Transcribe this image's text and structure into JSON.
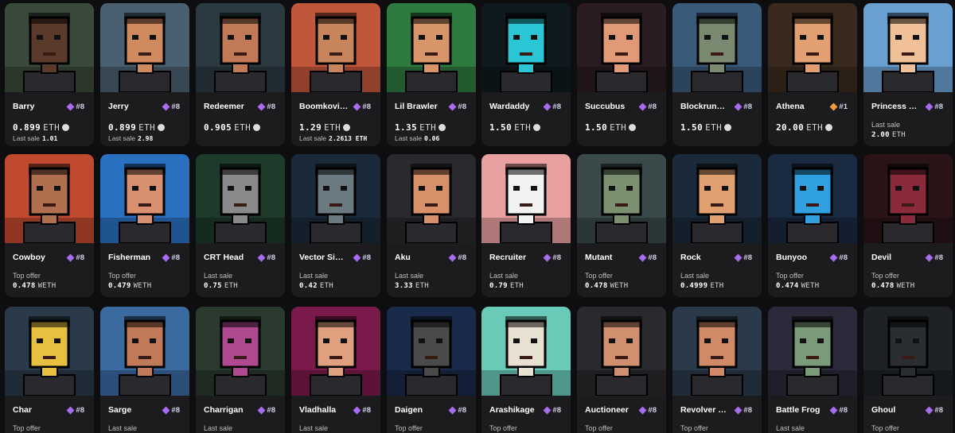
{
  "colors": {
    "background": "#0e0e10",
    "card": "#1c1c1f",
    "rank_gem": "#a86cf0",
    "rank_gem_top": "#f29b38"
  },
  "rows": [
    [
      {
        "name": "Barry",
        "rank": "#8",
        "price": "0.899",
        "currency": "ETH",
        "icon": "offer-icon",
        "sub_label": "Last sale",
        "sub_value": "1.01",
        "bg": "#3a4a3a",
        "skin": "#5a3a2a"
      },
      {
        "name": "Jerry",
        "rank": "#8",
        "price": "0.899",
        "currency": "ETH",
        "icon": "offer-icon",
        "sub_label": "Last sale",
        "sub_value": "2.98",
        "bg": "#4a6070",
        "skin": "#d08a60"
      },
      {
        "name": "Redeemer",
        "rank": "#8",
        "price": "0.905",
        "currency": "ETH",
        "icon": "eth-icon",
        "bg": "#2a3a40",
        "skin": "#c07a58"
      },
      {
        "name": "Boomkovi…",
        "rank": "#8",
        "price": "1.29",
        "currency": "ETH",
        "icon": "eth-icon",
        "sub_label": "Last sale",
        "sub_value": "2.2613 ETH",
        "bg": "#c0563a",
        "skin": "#c8845c"
      },
      {
        "name": "Lil Brawler",
        "rank": "#8",
        "price": "1.35",
        "currency": "ETH",
        "icon": "offer-icon",
        "sub_label": "Last sale",
        "sub_value": "0.06",
        "bg": "#2e7a40",
        "skin": "#d8956a"
      },
      {
        "name": "Wardaddy",
        "rank": "#8",
        "price": "1.50",
        "currency": "ETH",
        "icon": "eth-icon",
        "bg": "#0e1a1e",
        "skin": "#2ac6d6"
      },
      {
        "name": "Succubus",
        "rank": "#8",
        "price": "1.50",
        "currency": "ETH",
        "icon": "eth-icon",
        "bg": "#2a1c22",
        "skin": "#e09a78"
      },
      {
        "name": "Blockrun…",
        "rank": "#8",
        "price": "1.50",
        "currency": "ETH",
        "icon": "eth-icon",
        "bg": "#3a5a7a",
        "skin": "#7a8a70"
      },
      {
        "name": "Athena",
        "rank": "#1",
        "gold": true,
        "price": "20.00",
        "currency": "ETH",
        "icon": "eth-icon",
        "bg": "#3a2a1e",
        "skin": "#e2a072"
      },
      {
        "name": "Princess …",
        "rank": "#8",
        "label2": "Last sale",
        "price2": "2.00",
        "currency": "ETH",
        "bg": "#6aa0d0",
        "skin": "#f0c098"
      }
    ],
    [
      {
        "name": "Cowboy",
        "rank": "#8",
        "label2": "Top offer",
        "price2": "0.478",
        "currency": "WETH",
        "bg": "#c04a30",
        "skin": "#b07050"
      },
      {
        "name": "Fisherman",
        "rank": "#8",
        "label2": "Top offer",
        "price2": "0.479",
        "currency": "WETH",
        "bg": "#2a70c0",
        "skin": "#d89070"
      },
      {
        "name": "CRT Head",
        "rank": "#8",
        "label2": "Last sale",
        "price2": "0.75",
        "currency": "ETH",
        "bg": "#1e3a2a",
        "skin": "#8a8a8a"
      },
      {
        "name": "Vector Si…",
        "rank": "#8",
        "label2": "Last sale",
        "price2": "0.42",
        "currency": "ETH",
        "bg": "#1a2a3a",
        "skin": "#6a7a80"
      },
      {
        "name": "Aku",
        "rank": "#8",
        "label2": "Last sale",
        "price2": "3.33",
        "currency": "ETH",
        "bg": "#2a2a2e",
        "skin": "#d8906a"
      },
      {
        "name": "Recruiter",
        "rank": "#8",
        "label2": "Last sale",
        "price2": "0.79",
        "currency": "ETH",
        "bg": "#e8a0a0",
        "skin": "#f2f2f2"
      },
      {
        "name": "Mutant",
        "rank": "#8",
        "label2": "Top offer",
        "price2": "0.478",
        "currency": "WETH",
        "bg": "#3a4a4a",
        "skin": "#7a9070"
      },
      {
        "name": "Rock",
        "rank": "#8",
        "label2": "Last sale",
        "price2": "0.4999",
        "currency": "ETH",
        "bg": "#1a2a3a",
        "skin": "#e0a070"
      },
      {
        "name": "Bunyoo",
        "rank": "#8",
        "label2": "Top offer",
        "price2": "0.474",
        "currency": "WETH",
        "bg": "#1a2a40",
        "skin": "#30a0e0"
      },
      {
        "name": "Devil",
        "rank": "#8",
        "label2": "Top offer",
        "price2": "0.478",
        "currency": "WETH",
        "bg": "#2a1418",
        "skin": "#8a2a3a"
      }
    ],
    [
      {
        "name": "Char",
        "rank": "#8",
        "label2": "Top offer",
        "bg": "#2a3a4a",
        "skin": "#e8c040"
      },
      {
        "name": "Sarge",
        "rank": "#8",
        "label2": "Last sale",
        "bg": "#3a6aa0",
        "skin": "#c07a5a"
      },
      {
        "name": "Charrigan",
        "rank": "#8",
        "label2": "Last sale",
        "bg": "#2a3a2e",
        "skin": "#b04a90"
      },
      {
        "name": "Vladhalla",
        "rank": "#8",
        "label2": "Last sale",
        "bg": "#7a1a4a",
        "skin": "#e0a080"
      },
      {
        "name": "Daigen",
        "rank": "#8",
        "label2": "Top offer",
        "bg": "#1a2a4a",
        "skin": "#4a4a4a"
      },
      {
        "name": "Arashikage",
        "rank": "#8",
        "label2": "Top offer",
        "bg": "#6acab8",
        "skin": "#e8e0d0"
      },
      {
        "name": "Auctioneer",
        "rank": "#8",
        "label2": "Top offer",
        "bg": "#2a2a2e",
        "skin": "#d09070"
      },
      {
        "name": "Revolver …",
        "rank": "#8",
        "label2": "Top offer",
        "bg": "#2a3a4a",
        "skin": "#d08a68"
      },
      {
        "name": "Battle Frog",
        "rank": "#8",
        "label2": "Last sale",
        "bg": "#2a2a3a",
        "skin": "#7a9a7a"
      },
      {
        "name": "Ghoul",
        "rank": "#8",
        "label2": "Top offer",
        "bg": "#1e2226",
        "skin": "#2a2e30"
      }
    ]
  ]
}
